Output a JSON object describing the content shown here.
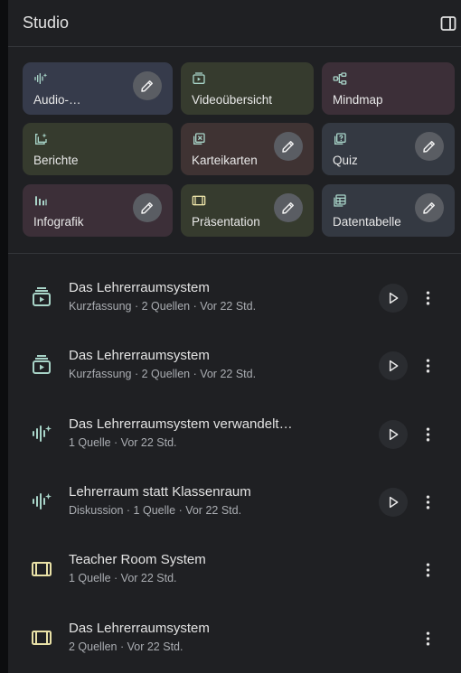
{
  "panel": {
    "title": "Studio"
  },
  "colors": {
    "bg": "#1f2023",
    "tile_blue": "#363b4b",
    "tile_green": "#363b2e",
    "tile_red": "#3f3333",
    "tile_purple": "#3c2f38",
    "tile_slate": "#343942",
    "icon_teal": "#a8d4c8",
    "icon_yellow": "#e9e1a7"
  },
  "tiles": [
    {
      "label": "Audio-…",
      "icon": "audio-wave-icon",
      "editable": true,
      "color": "#363b4b"
    },
    {
      "label": "Videoübersicht",
      "icon": "video-icon",
      "editable": false,
      "color": "#363b2e"
    },
    {
      "label": "Mindmap",
      "icon": "mindmap-icon",
      "editable": false,
      "color": "#3c2f38"
    },
    {
      "label": "Berichte",
      "icon": "report-icon",
      "editable": false,
      "color": "#363b2e"
    },
    {
      "label": "Karteikarten",
      "icon": "flashcards-icon",
      "editable": true,
      "color": "#3f3333"
    },
    {
      "label": "Quiz",
      "icon": "quiz-icon",
      "editable": true,
      "color": "#343942"
    },
    {
      "label": "Infografik",
      "icon": "infographic-icon",
      "editable": true,
      "color": "#3c2f38"
    },
    {
      "label": "Präsentation",
      "icon": "slides-icon",
      "editable": true,
      "color": "#363b2e"
    },
    {
      "label": "Datentabelle",
      "icon": "table-icon",
      "editable": true,
      "color": "#343942"
    }
  ],
  "items": [
    {
      "title": "Das Lehrerraumsystem",
      "meta": "Kurzfassung · 2 Quellen · Vor 22 Std.",
      "icon": "video-overview-icon",
      "playable": true
    },
    {
      "title": "Das Lehrerraumsystem",
      "meta": "Kurzfassung · 2 Quellen · Vor 22 Std.",
      "icon": "video-overview-icon",
      "playable": true
    },
    {
      "title": "Das Lehrerraumsystem verwandelt…",
      "meta": "1 Quelle · Vor 22 Std.",
      "icon": "audio-wave-icon",
      "playable": true
    },
    {
      "title": "Lehrerraum statt Klassenraum",
      "meta": "Diskussion · 1 Quelle · Vor 22 Std.",
      "icon": "audio-wave-icon",
      "playable": true
    },
    {
      "title": "Teacher Room System",
      "meta": "1 Quelle · Vor 22 Std.",
      "icon": "slides-icon",
      "playable": false
    },
    {
      "title": "Das Lehrerraumsystem",
      "meta": "2 Quellen · Vor 22 Std.",
      "icon": "slides-icon",
      "playable": false
    }
  ]
}
